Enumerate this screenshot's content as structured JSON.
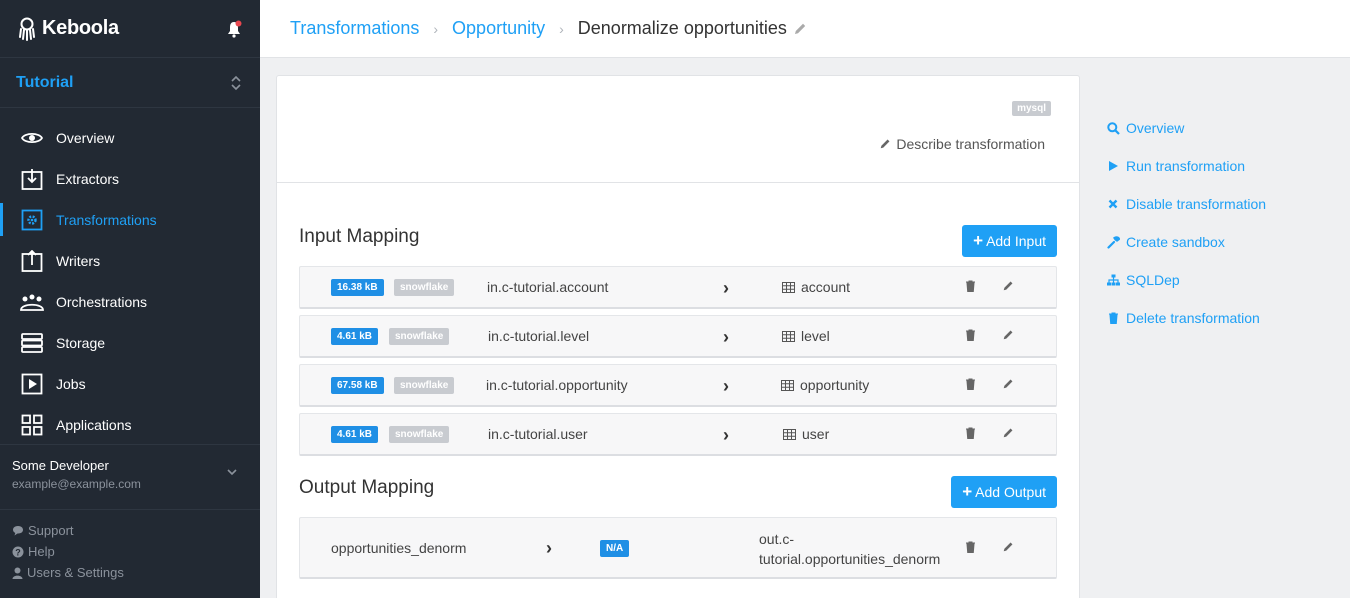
{
  "app": {
    "brand": "Keboola",
    "project": "Tutorial"
  },
  "sidebar": {
    "items": [
      {
        "label": "Overview",
        "icon": "eye-icon",
        "active": false
      },
      {
        "label": "Extractors",
        "icon": "download-box-icon",
        "active": false
      },
      {
        "label": "Transformations",
        "icon": "gear-box-icon",
        "active": true
      },
      {
        "label": "Writers",
        "icon": "upload-box-icon",
        "active": false
      },
      {
        "label": "Orchestrations",
        "icon": "orchestra-icon",
        "active": false
      },
      {
        "label": "Storage",
        "icon": "storage-icon",
        "active": false
      },
      {
        "label": "Jobs",
        "icon": "play-box-icon",
        "active": false
      },
      {
        "label": "Applications",
        "icon": "grid-icon",
        "active": false
      }
    ],
    "user": {
      "name": "Some Developer",
      "email": "example@example.com"
    },
    "footer": [
      "Support",
      "Help",
      "Users & Settings"
    ]
  },
  "breadcrumb": {
    "items": [
      "Transformations",
      "Opportunity"
    ],
    "current": "Denormalize opportunities"
  },
  "transformation": {
    "backend": "mysql",
    "describe_label": "Describe transformation",
    "input_title": "Input Mapping",
    "add_input_label": "Add Input",
    "inputs": [
      {
        "size": "16.38 kB",
        "backend": "snowflake",
        "source": "in.c-tutorial.account",
        "dest": "account"
      },
      {
        "size": "4.61 kB",
        "backend": "snowflake",
        "source": "in.c-tutorial.level",
        "dest": "level"
      },
      {
        "size": "67.58 kB",
        "backend": "snowflake",
        "source": "in.c-tutorial.opportunity",
        "dest": "opportunity"
      },
      {
        "size": "4.61 kB",
        "backend": "snowflake",
        "source": "in.c-tutorial.user",
        "dest": "user"
      }
    ],
    "output_title": "Output Mapping",
    "add_output_label": "Add Output",
    "outputs": [
      {
        "source": "opportunities_denorm",
        "size": "N/A",
        "dest_line1": "out.c-",
        "dest_line2": "tutorial.opportunities_denorm"
      }
    ]
  },
  "actions": [
    {
      "label": "Overview",
      "icon": "search-icon"
    },
    {
      "label": "Run transformation",
      "icon": "play-icon"
    },
    {
      "label": "Disable transformation",
      "icon": "x-icon"
    },
    {
      "label": "Create sandbox",
      "icon": "wrench-icon"
    },
    {
      "label": "SQLDep",
      "icon": "sitemap-icon"
    },
    {
      "label": "Delete transformation",
      "icon": "trash-icon"
    }
  ],
  "colors": {
    "accent": "#1fa0f5",
    "sidebar": "#222933",
    "badge_gray": "#c8cbd0"
  }
}
